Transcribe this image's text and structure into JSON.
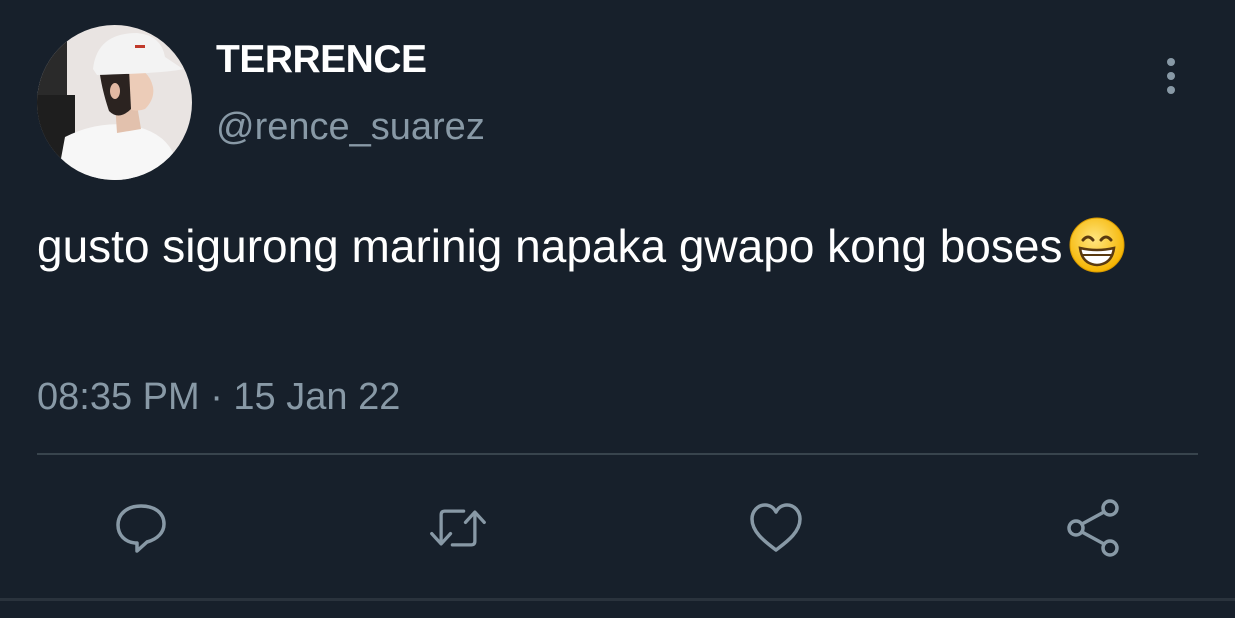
{
  "user": {
    "display_name": "TERRENCE",
    "handle": "@rence_suarez"
  },
  "tweet": {
    "text": "gusto sigurong marinig napaka gwapo kong boses",
    "emoji": "grinning-face-with-smiling-eyes",
    "timestamp": "08:35 PM · 15 Jan 22"
  },
  "actions": [
    "reply-icon",
    "retweet-icon",
    "like-icon",
    "share-icon"
  ],
  "colors": {
    "background": "#17202b",
    "primary_text": "#ffffff",
    "secondary_text": "#8899a6",
    "icon": "#8899a6",
    "divider": "#38444d"
  }
}
